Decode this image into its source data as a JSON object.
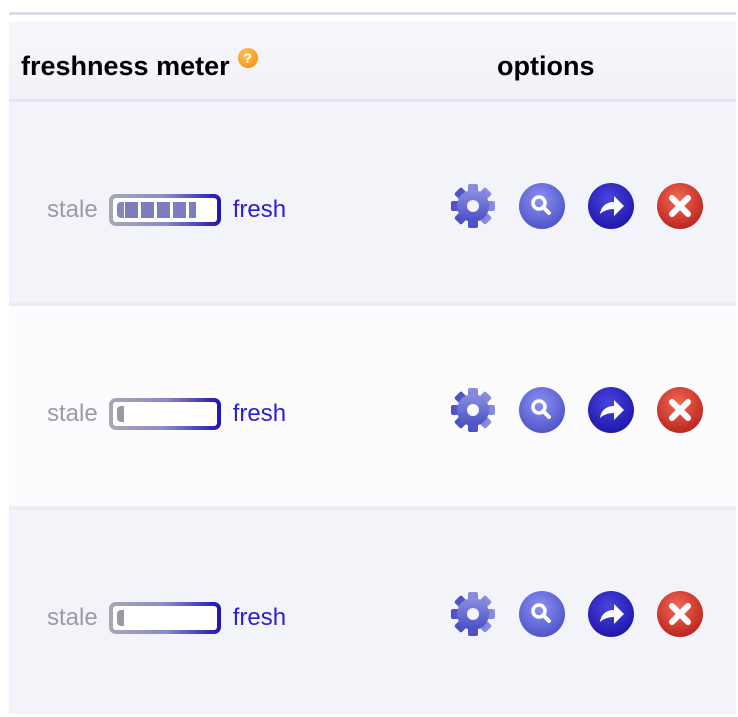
{
  "header": {
    "meter_title": "freshness meter",
    "help_glyph": "?",
    "options_title": "options"
  },
  "icons": [
    "gear-icon",
    "magnifier-icon",
    "share-arrow-icon",
    "close-icon"
  ],
  "colors": {
    "fresh": "#2b1fd6",
    "stale": "#9b9ba6",
    "help": "#f08a00",
    "delete": "#d9312b",
    "option_blue": "#5a5fd6"
  },
  "rows": [
    {
      "stale_label": "stale",
      "fresh_label": "fresh",
      "freshness": 0.85
    },
    {
      "stale_label": "stale",
      "fresh_label": "fresh",
      "freshness": 0.0
    },
    {
      "stale_label": "stale",
      "fresh_label": "fresh",
      "freshness": 0.0
    }
  ]
}
